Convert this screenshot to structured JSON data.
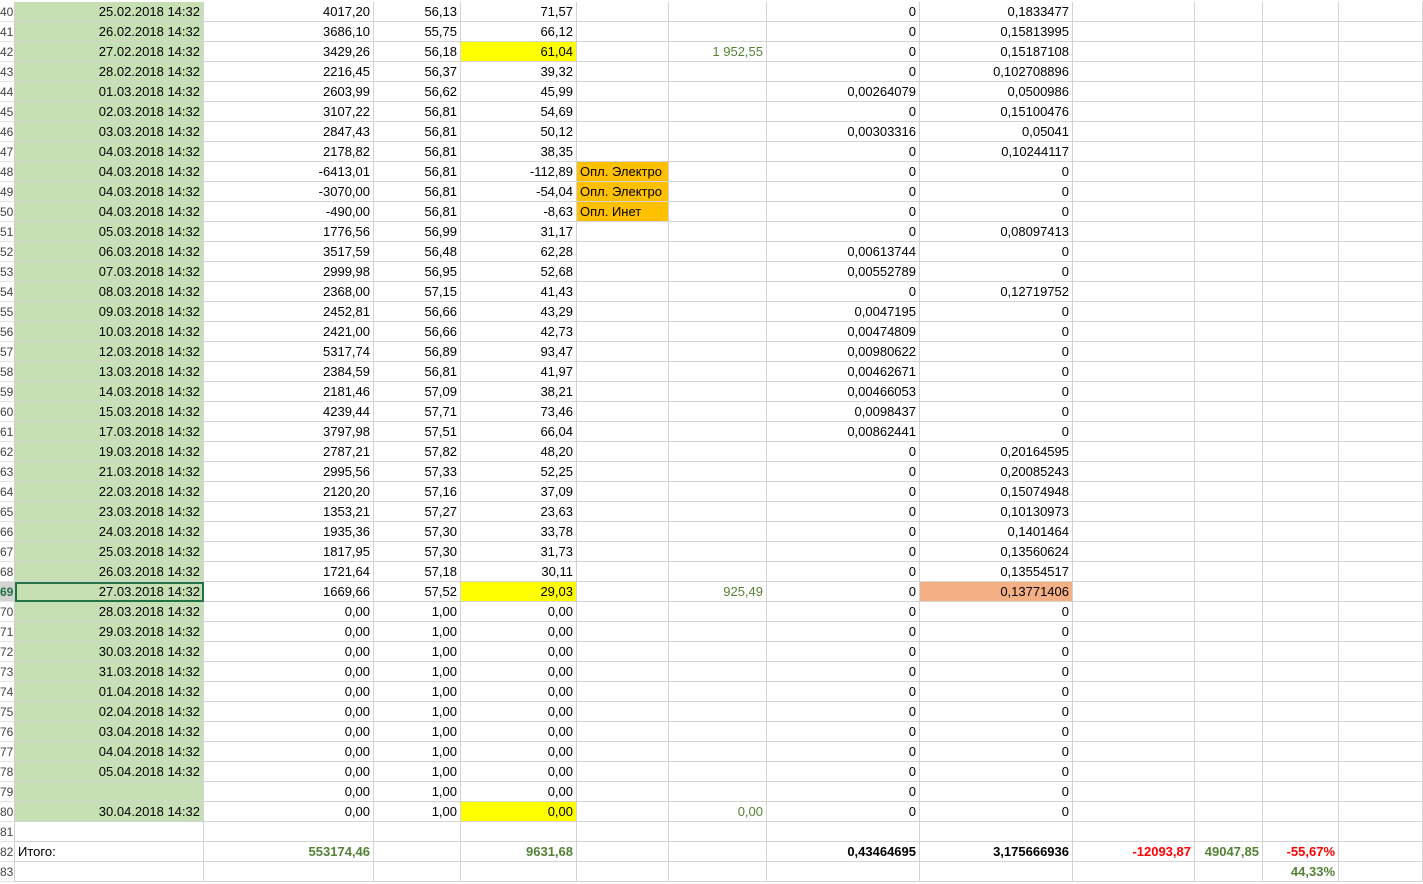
{
  "sheet": {
    "rows": [
      {
        "n": "40",
        "date": "25.02.2018 14:32",
        "c": "4017,20",
        "d": "56,13",
        "e": "71,57",
        "f": "",
        "g": "",
        "h": "0",
        "i": "0,1833477"
      },
      {
        "n": "41",
        "date": "26.02.2018 14:32",
        "c": "3686,10",
        "d": "55,75",
        "e": "66,12",
        "f": "",
        "g": "",
        "h": "0",
        "i": "0,15813995"
      },
      {
        "n": "42",
        "date": "27.02.2018 14:32",
        "c": "3429,26",
        "d": "56,18",
        "e": "61,04",
        "f": "",
        "g": "1 952,55",
        "h": "0",
        "i": "0,15187108",
        "e_hl": "yellow"
      },
      {
        "n": "43",
        "date": "28.02.2018 14:32",
        "c": "2216,45",
        "d": "56,37",
        "e": "39,32",
        "f": "",
        "g": "",
        "h": "0",
        "i": "0,102708896"
      },
      {
        "n": "44",
        "date": "01.03.2018 14:32",
        "c": "2603,99",
        "d": "56,62",
        "e": "45,99",
        "f": "",
        "g": "",
        "h": "0,00264079",
        "i": "0,0500986"
      },
      {
        "n": "45",
        "date": "02.03.2018 14:32",
        "c": "3107,22",
        "d": "56,81",
        "e": "54,69",
        "f": "",
        "g": "",
        "h": "0",
        "i": "0,15100476"
      },
      {
        "n": "46",
        "date": "03.03.2018 14:32",
        "c": "2847,43",
        "d": "56,81",
        "e": "50,12",
        "f": "",
        "g": "",
        "h": "0,00303316",
        "i": "0,05041"
      },
      {
        "n": "47",
        "date": "04.03.2018 14:32",
        "c": "2178,82",
        "d": "56,81",
        "e": "38,35",
        "f": "",
        "g": "",
        "h": "0",
        "i": "0,10244117"
      },
      {
        "n": "48",
        "date": "04.03.2018 14:32",
        "c": "-6413,01",
        "d": "56,81",
        "e": "-112,89",
        "f": "Опл. Электро",
        "g": "",
        "h": "0",
        "i": "0"
      },
      {
        "n": "49",
        "date": "04.03.2018 14:32",
        "c": "-3070,00",
        "d": "56,81",
        "e": "-54,04",
        "f": "Опл. Электро",
        "g": "",
        "h": "0",
        "i": "0"
      },
      {
        "n": "50",
        "date": "04.03.2018 14:32",
        "c": "-490,00",
        "d": "56,81",
        "e": "-8,63",
        "f": "Опл. Инет",
        "g": "",
        "h": "0",
        "i": "0"
      },
      {
        "n": "51",
        "date": "05.03.2018 14:32",
        "c": "1776,56",
        "d": "56,99",
        "e": "31,17",
        "f": "",
        "g": "",
        "h": "0",
        "i": "0,08097413"
      },
      {
        "n": "52",
        "date": "06.03.2018 14:32",
        "c": "3517,59",
        "d": "56,48",
        "e": "62,28",
        "f": "",
        "g": "",
        "h": "0,00613744",
        "i": "0"
      },
      {
        "n": "53",
        "date": "07.03.2018 14:32",
        "c": "2999,98",
        "d": "56,95",
        "e": "52,68",
        "f": "",
        "g": "",
        "h": "0,00552789",
        "i": "0"
      },
      {
        "n": "54",
        "date": "08.03.2018 14:32",
        "c": "2368,00",
        "d": "57,15",
        "e": "41,43",
        "f": "",
        "g": "",
        "h": "0",
        "i": "0,12719752"
      },
      {
        "n": "55",
        "date": "09.03.2018 14:32",
        "c": "2452,81",
        "d": "56,66",
        "e": "43,29",
        "f": "",
        "g": "",
        "h": "0,0047195",
        "i": "0"
      },
      {
        "n": "56",
        "date": "10.03.2018 14:32",
        "c": "2421,00",
        "d": "56,66",
        "e": "42,73",
        "f": "",
        "g": "",
        "h": "0,00474809",
        "i": "0"
      },
      {
        "n": "57",
        "date": "12.03.2018 14:32",
        "c": "5317,74",
        "d": "56,89",
        "e": "93,47",
        "f": "",
        "g": "",
        "h": "0,00980622",
        "i": "0"
      },
      {
        "n": "58",
        "date": "13.03.2018 14:32",
        "c": "2384,59",
        "d": "56,81",
        "e": "41,97",
        "f": "",
        "g": "",
        "h": "0,00462671",
        "i": "0"
      },
      {
        "n": "59",
        "date": "14.03.2018 14:32",
        "c": "2181,46",
        "d": "57,09",
        "e": "38,21",
        "f": "",
        "g": "",
        "h": "0,00466053",
        "i": "0"
      },
      {
        "n": "60",
        "date": "15.03.2018 14:32",
        "c": "4239,44",
        "d": "57,71",
        "e": "73,46",
        "f": "",
        "g": "",
        "h": "0,0098437",
        "i": "0"
      },
      {
        "n": "61",
        "date": "17.03.2018 14:32",
        "c": "3797,98",
        "d": "57,51",
        "e": "66,04",
        "f": "",
        "g": "",
        "h": "0,00862441",
        "i": "0"
      },
      {
        "n": "62",
        "date": "19.03.2018 14:32",
        "c": "2787,21",
        "d": "57,82",
        "e": "48,20",
        "f": "",
        "g": "",
        "h": "0",
        "i": "0,20164595"
      },
      {
        "n": "63",
        "date": "21.03.2018 14:32",
        "c": "2995,56",
        "d": "57,33",
        "e": "52,25",
        "f": "",
        "g": "",
        "h": "0",
        "i": "0,20085243"
      },
      {
        "n": "64",
        "date": "22.03.2018 14:32",
        "c": "2120,20",
        "d": "57,16",
        "e": "37,09",
        "f": "",
        "g": "",
        "h": "0",
        "i": "0,15074948"
      },
      {
        "n": "65",
        "date": "23.03.2018 14:32",
        "c": "1353,21",
        "d": "57,27",
        "e": "23,63",
        "f": "",
        "g": "",
        "h": "0",
        "i": "0,10130973"
      },
      {
        "n": "66",
        "date": "24.03.2018 14:32",
        "c": "1935,36",
        "d": "57,30",
        "e": "33,78",
        "f": "",
        "g": "",
        "h": "0",
        "i": "0,1401464"
      },
      {
        "n": "67",
        "date": "25.03.2018 14:32",
        "c": "1817,95",
        "d": "57,30",
        "e": "31,73",
        "f": "",
        "g": "",
        "h": "0",
        "i": "0,13560624"
      },
      {
        "n": "68",
        "date": "26.03.2018 14:32",
        "c": "1721,64",
        "d": "57,18",
        "e": "30,11",
        "f": "",
        "g": "",
        "h": "0",
        "i": "0,13554517"
      },
      {
        "n": "69",
        "date": "27.03.2018 14:32",
        "c": "1669,66",
        "d": "57,52",
        "e": "29,03",
        "f": "",
        "g": "925,49",
        "h": "0",
        "i": "0,13771406",
        "e_hl": "yellow",
        "i_hl": "salmon",
        "active": true
      },
      {
        "n": "70",
        "date": "28.03.2018 14:32",
        "c": "0,00",
        "d": "1,00",
        "e": "0,00",
        "f": "",
        "g": "",
        "h": "0",
        "i": "0"
      },
      {
        "n": "71",
        "date": "29.03.2018 14:32",
        "c": "0,00",
        "d": "1,00",
        "e": "0,00",
        "f": "",
        "g": "",
        "h": "0",
        "i": "0"
      },
      {
        "n": "72",
        "date": "30.03.2018 14:32",
        "c": "0,00",
        "d": "1,00",
        "e": "0,00",
        "f": "",
        "g": "",
        "h": "0",
        "i": "0"
      },
      {
        "n": "73",
        "date": "31.03.2018 14:32",
        "c": "0,00",
        "d": "1,00",
        "e": "0,00",
        "f": "",
        "g": "",
        "h": "0",
        "i": "0"
      },
      {
        "n": "74",
        "date": "01.04.2018 14:32",
        "c": "0,00",
        "d": "1,00",
        "e": "0,00",
        "f": "",
        "g": "",
        "h": "0",
        "i": "0"
      },
      {
        "n": "75",
        "date": "02.04.2018 14:32",
        "c": "0,00",
        "d": "1,00",
        "e": "0,00",
        "f": "",
        "g": "",
        "h": "0",
        "i": "0"
      },
      {
        "n": "76",
        "date": "03.04.2018 14:32",
        "c": "0,00",
        "d": "1,00",
        "e": "0,00",
        "f": "",
        "g": "",
        "h": "0",
        "i": "0"
      },
      {
        "n": "77",
        "date": "04.04.2018 14:32",
        "c": "0,00",
        "d": "1,00",
        "e": "0,00",
        "f": "",
        "g": "",
        "h": "0",
        "i": "0"
      },
      {
        "n": "78",
        "date": "05.04.2018 14:32",
        "c": "0,00",
        "d": "1,00",
        "e": "0,00",
        "f": "",
        "g": "",
        "h": "0",
        "i": "0"
      },
      {
        "n": "79",
        "date": "",
        "c": "0,00",
        "d": "1,00",
        "e": "0,00",
        "f": "",
        "g": "",
        "h": "0",
        "i": "0"
      },
      {
        "n": "80",
        "date": "30.04.2018 14:32",
        "c": "0,00",
        "d": "1,00",
        "e": "0,00",
        "f": "",
        "g": "0,00",
        "h": "0",
        "i": "0",
        "e_hl": "yellow"
      }
    ],
    "empty_row": {
      "n": "81"
    },
    "total_row": {
      "n": "82",
      "label": "Итого:",
      "c": "553174,46",
      "e": "9631,68",
      "h": "0,43464695",
      "i": "3,175666936",
      "j": "-12093,87",
      "k": "49047,85",
      "l": "-55,67%"
    },
    "last_row": {
      "n": "83",
      "l": "44,33%"
    }
  }
}
